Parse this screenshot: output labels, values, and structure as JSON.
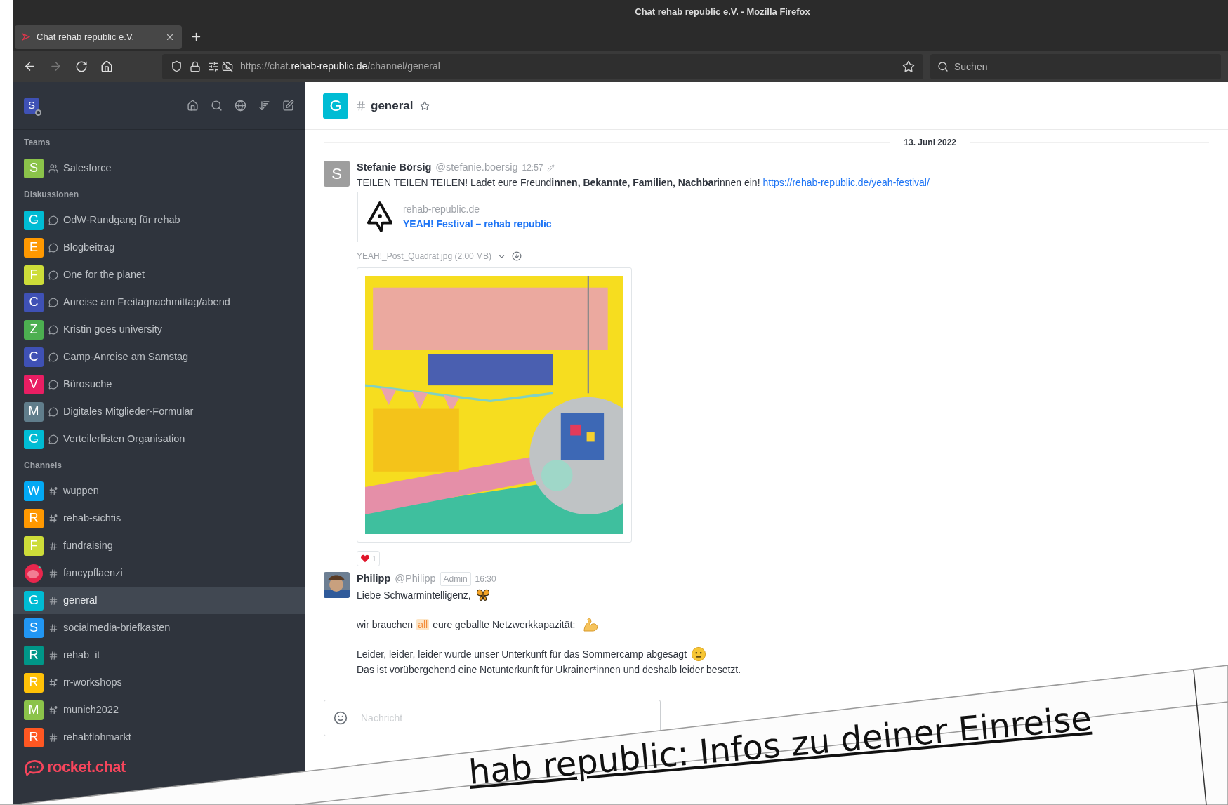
{
  "window": {
    "title": "Chat rehab republic e.V. - Mozilla Firefox"
  },
  "tabs": [
    {
      "title": "Chat rehab republic e.V.",
      "selected": true
    }
  ],
  "toolbar": {
    "forward_disabled": true,
    "url": {
      "host_prefix": "https://chat.",
      "domain": "rehab-republic.de",
      "path": "/channel/general"
    },
    "search": {
      "placeholder": "Suchen"
    }
  },
  "sidebar": {
    "user_initial": "S",
    "sections": [
      {
        "heading": "Teams",
        "items": [
          {
            "name": "Salesforce",
            "initial": "S",
            "color": "#8bc34a",
            "kind": "team",
            "selected": false
          }
        ]
      },
      {
        "heading": "Diskussionen",
        "items": [
          {
            "name": "OdW-Rundgang für rehab",
            "initial": "G",
            "color": "#00bcd4",
            "kind": "discussion",
            "selected": false
          },
          {
            "name": "Blogbeitrag",
            "initial": "E",
            "color": "#ff9800",
            "kind": "discussion",
            "selected": false
          },
          {
            "name": "One for the planet",
            "initial": "F",
            "color": "#cddc39",
            "kind": "discussion",
            "selected": false
          },
          {
            "name": "Anreise am Freitagnachmittag/abend",
            "initial": "C",
            "color": "#3f51b5",
            "kind": "discussion",
            "selected": false
          },
          {
            "name": "Kristin goes university",
            "initial": "Z",
            "color": "#4caf50",
            "kind": "discussion",
            "selected": false
          },
          {
            "name": "Camp-Anreise am Samstag",
            "initial": "C",
            "color": "#3f51b5",
            "kind": "discussion",
            "selected": false
          },
          {
            "name": "Bürosuche",
            "initial": "V",
            "color": "#e91e63",
            "kind": "discussion",
            "selected": false
          },
          {
            "name": "Digitales Mitglieder-Formular",
            "initial": "M",
            "color": "#607d8b",
            "kind": "discussion",
            "selected": false
          },
          {
            "name": "Verteilerlisten Organisation",
            "initial": "G",
            "color": "#00bcd4",
            "kind": "discussion",
            "selected": false
          }
        ]
      },
      {
        "heading": "Channels",
        "items": [
          {
            "name": "wuppen",
            "initial": "W",
            "color": "#03a9f4",
            "kind": "channel-dot",
            "selected": false
          },
          {
            "name": "rehab-sichtis",
            "initial": "R",
            "color": "#ff9800",
            "kind": "channel-dot",
            "selected": false
          },
          {
            "name": "fundraising",
            "initial": "F",
            "color": "#cddc39",
            "kind": "channel",
            "selected": false
          },
          {
            "name": "fancypflaenzi",
            "kind": "channel",
            "selected": false
          },
          {
            "name": "general",
            "initial": "G",
            "color": "#00bcd4",
            "kind": "channel",
            "selected": true
          },
          {
            "name": "socialmedia-briefkasten",
            "initial": "S",
            "color": "#2196f3",
            "kind": "channel",
            "selected": false
          },
          {
            "name": "rehab_it",
            "initial": "R",
            "color": "#009688",
            "kind": "channel",
            "selected": false
          },
          {
            "name": "rr-workshops",
            "initial": "R",
            "color": "#ffc107",
            "kind": "channel-dot",
            "selected": false
          },
          {
            "name": "munich2022",
            "initial": "M",
            "color": "#8bc34a",
            "kind": "channel-dot",
            "selected": false
          },
          {
            "name": "rehabflohmarkt",
            "initial": "R",
            "color": "#ff5722",
            "kind": "channel",
            "selected": false
          }
        ]
      }
    ],
    "logo": "rocket.chat"
  },
  "channel": {
    "initial": "G",
    "name": "general"
  },
  "date_divider": "13. Juni 2022",
  "messages": [
    {
      "author": "Stefanie Börsig",
      "username": "@stefanie.boersig",
      "time": "12:57",
      "edited": true,
      "avatar_initial": "S",
      "text": "TEILEN TEILEN TEILEN! Ladet eure Freund**innen, Bekannte, Familien, Nachbar**innen ein!",
      "link": "https://rehab-republic.de/yeah-festival/",
      "preview": {
        "site": "rehab-republic.de",
        "title": "YEAH! Festival – rehab republic"
      },
      "attachment": {
        "file": "YEAH!_Post_Quadrat.jpg (2.00 MB)",
        "kind": "picture"
      },
      "reactions": [
        {
          "count": "1"
        }
      ]
    },
    {
      "author": "Philipp",
      "username": "@Philipp",
      "role": "Admin",
      "time": "16:30",
      "paragraphs": [
        [
          {
            "segments": [
              {
                "kind": "text",
                "text": "Liebe Schwarmintelligenz,"
              },
              {
                "kind": "butterfly"
              }
            ]
          }
        ],
        [
          {
            "segments": [
              {
                "kind": "text",
                "text": "wir brauchen"
              },
              {
                "kind": "mention",
                "text": "all"
              },
              {
                "kind": "text",
                "text": "eure geballte Netzwerkkapazität:"
              },
              {
                "kind": "arm"
              }
            ]
          }
        ],
        [
          {
            "segments": [
              {
                "kind": "text",
                "text": "Leider, leider, leider wurde unser Unterkunft für das Sommercamp abgesagt"
              },
              {
                "kind": "neutral"
              }
            ]
          },
          {
            "segments": [
              {
                "kind": "text",
                "text": "Das ist vorübergehend eine Notunterkunft für Ukrainer*innen und deshalb leider besetzt."
              }
            ]
          }
        ]
      ]
    }
  ],
  "composer": {
    "placeholder": "Nachricht"
  },
  "paper": {
    "title": "hab republic: Infos zu deiner Einreise"
  }
}
